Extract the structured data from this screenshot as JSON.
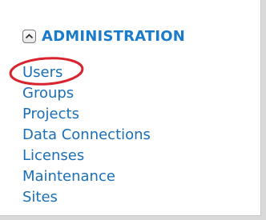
{
  "section": {
    "title": "ADMINISTRATION",
    "collapse_icon": "chevron-up-icon"
  },
  "links": [
    {
      "label": "Users"
    },
    {
      "label": "Groups"
    },
    {
      "label": "Projects"
    },
    {
      "label": "Data Connections"
    },
    {
      "label": "Licenses"
    },
    {
      "label": "Maintenance"
    },
    {
      "label": "Sites"
    }
  ],
  "colors": {
    "title": "#1a7acb",
    "link": "#1a6fb5",
    "annotation_circle": "#d9232e"
  }
}
